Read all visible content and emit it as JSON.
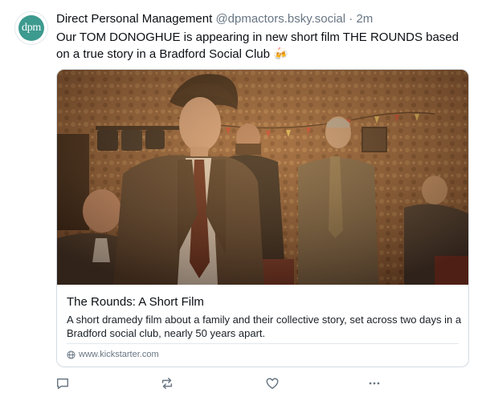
{
  "post": {
    "avatar_text": "dpm",
    "display_name": "Direct Personal Management",
    "handle": "@dpmactors.bsky.social",
    "separator": "·",
    "time": "2m",
    "text": "Our TOM DONOGHUE is appearing in new short film THE ROUNDS based on a true story in a Bradford Social Club 🍻",
    "embed": {
      "title": "The Rounds: A Short Film",
      "description": "A short dramedy film about a family and their collective story, set across two days in a Bradford social club, nearly 50 years apart.",
      "domain": "www.kickstarter.com",
      "image_alt": "Young man in brown suit and tie standing in a social club with a film crew in the background"
    },
    "actions": {
      "reply_icon": "reply-icon",
      "repost_icon": "repost-icon",
      "like_icon": "heart-icon",
      "more_icon": "more-icon"
    },
    "colors": {
      "avatar_bg": "#3d9a8f",
      "muted_text": "#687684",
      "border": "#d4dbe2"
    }
  }
}
